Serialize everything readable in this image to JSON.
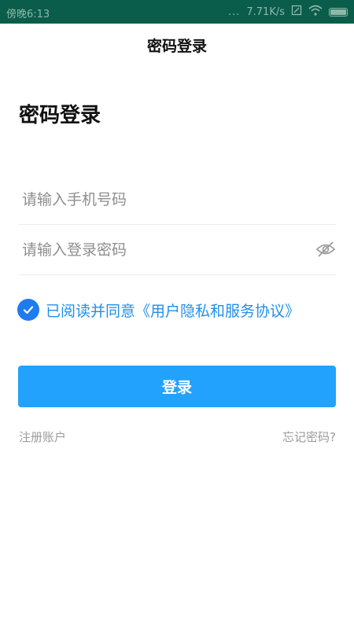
{
  "status_bar": {
    "time": "傍晚6:13",
    "dots": "...",
    "speed": "7.71K/s"
  },
  "header": {
    "title": "密码登录"
  },
  "main": {
    "heading": "密码登录",
    "phone_placeholder": "请输入手机号码",
    "password_placeholder": "请输入登录密码",
    "agreement_text": "已阅读并同意《用户隐私和服务协议》",
    "agreement_checked": true,
    "login_label": "登录",
    "register_label": "注册账户",
    "forgot_label": "忘记密码?"
  },
  "colors": {
    "status_bar": "#0a5d4a",
    "primary_button": "#22a2fd",
    "link_blue": "#2190ea",
    "check_blue": "#1f7bf0"
  },
  "icons": [
    "signal-icon",
    "wifi-icon",
    "battery-icon",
    "eye-off-icon",
    "check-icon"
  ]
}
